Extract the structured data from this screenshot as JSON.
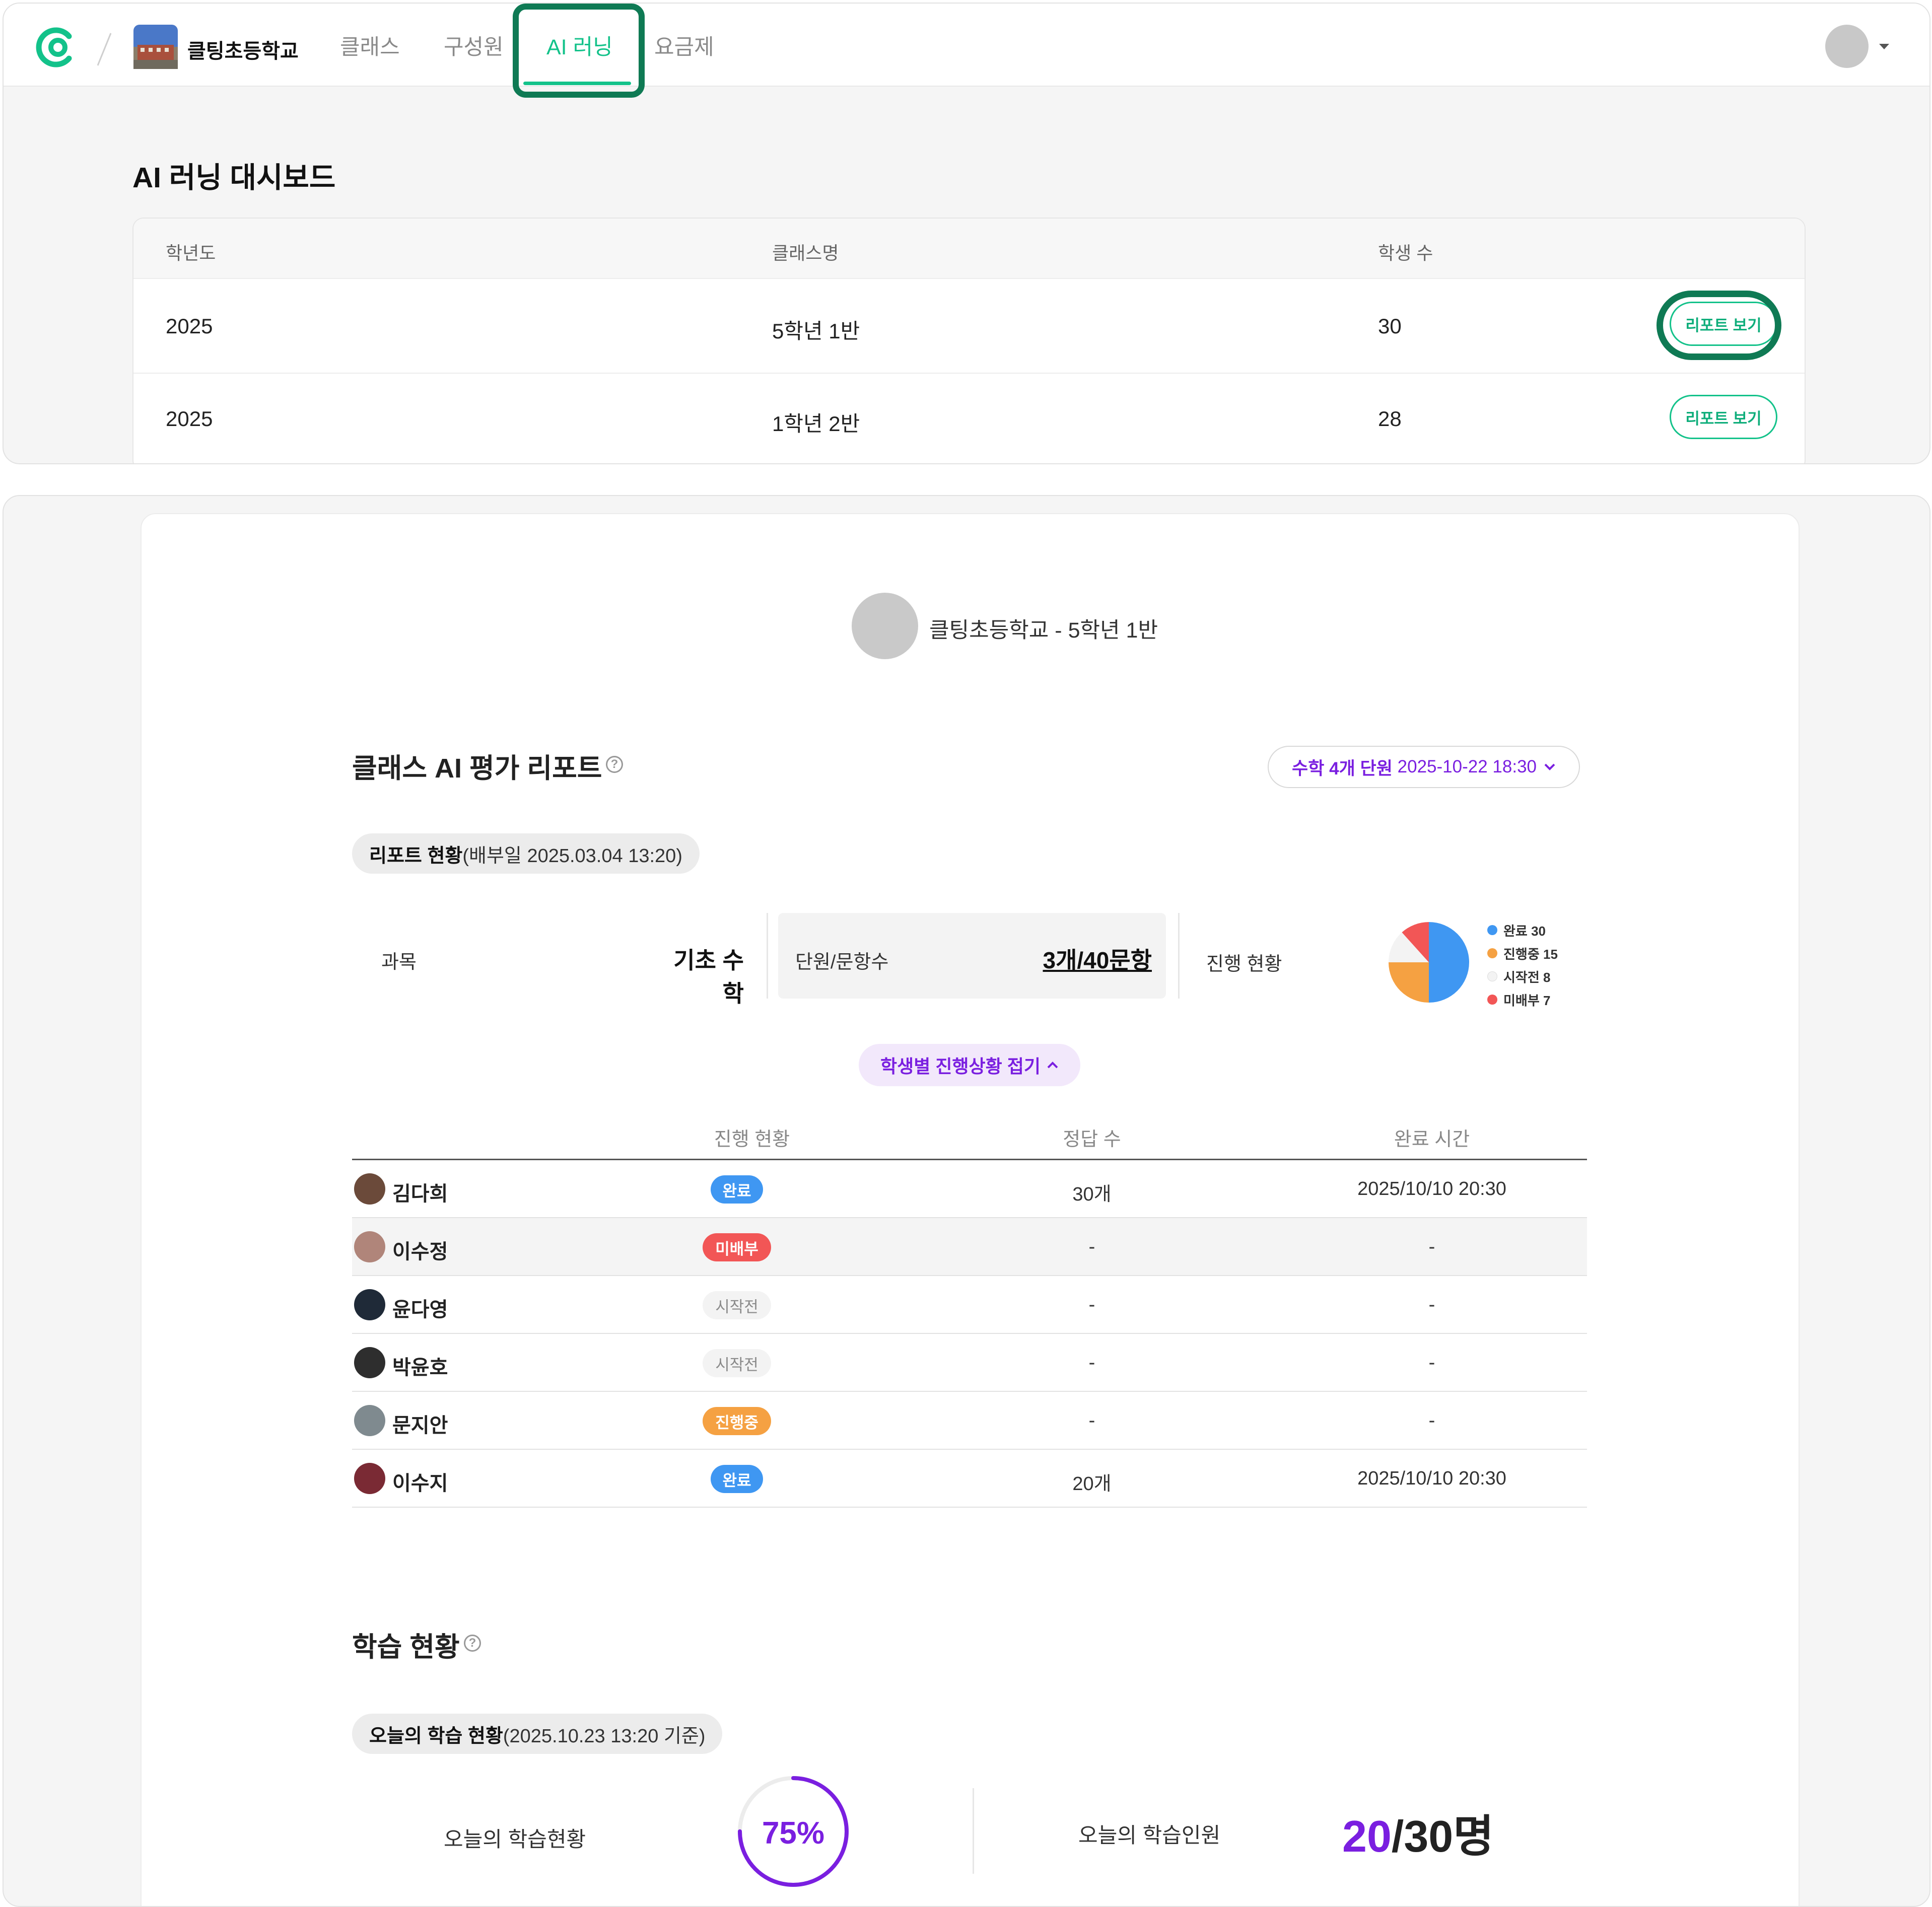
{
  "header": {
    "school_name": "클팅초등학교",
    "nav_tabs": [
      "클래스",
      "구성원",
      "AI 러닝",
      "요금제"
    ],
    "active_tab": "AI 러닝"
  },
  "dashboard": {
    "title": "AI 러닝 대시보드",
    "columns": [
      "학년도",
      "클래스명",
      "학생 수"
    ],
    "rows": [
      {
        "year": "2025",
        "class_name": "5학년 1반",
        "students": "30",
        "action": "리포트 보기"
      },
      {
        "year": "2025",
        "class_name": "1학년 2반",
        "students": "28",
        "action": "리포트 보기"
      }
    ]
  },
  "report": {
    "class_label": "클팅초등학교 - 5학년 1반",
    "title": "클래스 AI 평가 리포트",
    "help": "?",
    "selector": {
      "bold": "수학 4개 단원",
      "date": "2025-10-22 18:30"
    },
    "status_pill": {
      "bold": "리포트 현황",
      "rest": "(배부일 2025.03.04 13:20)"
    },
    "subject_label": "과목",
    "subject_value": "기초 수학",
    "units_label": "단원/문항수",
    "units_value": "3개/40문항",
    "progress_label": "진행 현황",
    "pie": [
      {
        "label": "완료 30",
        "value": 30,
        "color": "#3f97f2"
      },
      {
        "label": "진행중 15",
        "value": 15,
        "color": "#f5a142"
      },
      {
        "label": "시작전 8",
        "value": 8,
        "color": "#f3f3f3"
      },
      {
        "label": "미배부 7",
        "value": 7,
        "color": "#f25656"
      }
    ],
    "toggle_label": "학생별 진행상황 접기",
    "student_columns": [
      "진행 현황",
      "정답 수",
      "완료 시간"
    ],
    "students": [
      {
        "name": "김다희",
        "status": "완료",
        "correct": "30개",
        "time": "2025/10/10 20:30"
      },
      {
        "name": "이수정",
        "status": "미배부",
        "correct": "-",
        "time": "-"
      },
      {
        "name": "윤다영",
        "status": "시작전",
        "correct": "-",
        "time": "-"
      },
      {
        "name": "박윤호",
        "status": "시작전",
        "correct": "-",
        "time": "-"
      },
      {
        "name": "문지안",
        "status": "진행중",
        "correct": "-",
        "time": "-"
      },
      {
        "name": "이수지",
        "status": "완료",
        "correct": "20개",
        "time": "2025/10/10 20:30"
      }
    ]
  },
  "learning": {
    "title": "학습 현황",
    "help": "?",
    "pill": {
      "bold": "오늘의 학습 현황",
      "rest": "(2025.10.23 13:20 기준)"
    },
    "rate_label": "오늘의 학습현황",
    "rate_value": "75%",
    "rate_fraction": 0.75,
    "people_label": "오늘의 학습인원",
    "people_current": "20",
    "people_total": "/30명"
  },
  "colors": {
    "brand": "#13c28a",
    "highlight": "#0f7a54",
    "accent_purple": "#7a1fe0"
  }
}
